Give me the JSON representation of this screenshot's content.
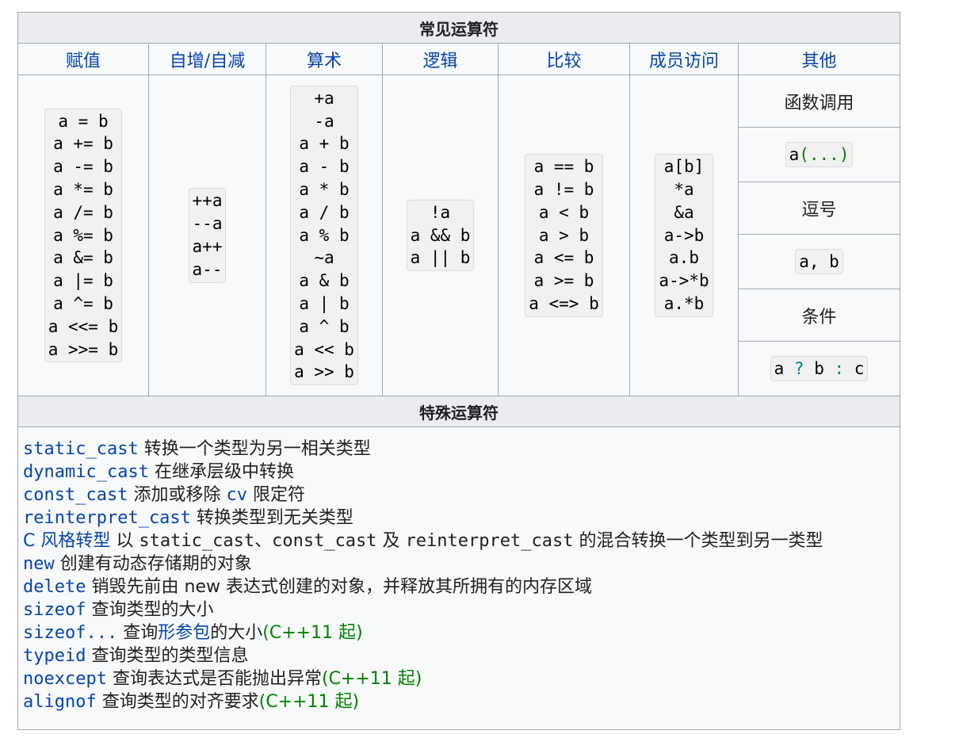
{
  "common": {
    "title": "常见运算符",
    "headers": [
      "赋值",
      "自增/自减",
      "算术",
      "逻辑",
      "比较",
      "成员访问",
      "其他"
    ],
    "assign": [
      "a = b",
      "a += b",
      "a -= b",
      "a *= b",
      "a /= b",
      "a %= b",
      "a &= b",
      "a |= b",
      "a ^= b",
      "a <<= b",
      "a >>= b"
    ],
    "incdec": [
      "++a",
      "--a",
      "a++",
      "a--"
    ],
    "arith": [
      "+a",
      "-a",
      "a + b",
      "a - b",
      "a * b",
      "a / b",
      "a % b",
      "~a",
      "a & b",
      "a | b",
      "a ^ b",
      "a << b",
      "a >> b"
    ],
    "logic": [
      "!a",
      "a && b",
      "a || b"
    ],
    "compare": [
      "a == b",
      "a != b",
      "a < b",
      "a > b",
      "a <= b",
      "a >= b",
      "a <=> b"
    ],
    "member": [
      "a[b]",
      "*a",
      "&a",
      "a->b",
      "a.b",
      "a->*b",
      "a.*b"
    ],
    "other": {
      "call_label": "函数调用",
      "call_code": "a(...)",
      "comma_label": "逗号",
      "comma_code": "a, b",
      "cond_label": "条件",
      "cond_code": "a ? b : c"
    }
  },
  "special": {
    "title": "特殊运算符",
    "lines": [
      {
        "name": "static_cast",
        "desc": "转换一个类型为另一相关类型"
      },
      {
        "name": "dynamic_cast",
        "desc": "在继承层级中转换"
      },
      {
        "name": "const_cast",
        "desc_pre": "添加或移除",
        "desc_code": "cv",
        "desc_post": "限定符"
      },
      {
        "name": "reinterpret_cast",
        "desc": "转换类型到无关类型"
      },
      {
        "name": "C 风格转型",
        "desc_1": "以",
        "code_1": "static_cast",
        "sep": "、",
        "code_2": "const_cast",
        "desc_2": "及",
        "code_3": "reinterpret_cast",
        "desc_3": "的混合转换一个类型到另一类型"
      },
      {
        "name": "new",
        "desc": "创建有动态存储期的对象"
      },
      {
        "name": "delete",
        "desc_pre": "销毁先前由",
        "desc_link": "new",
        "desc_post": "表达式创建的对象，并释放其所拥有的内存区域"
      },
      {
        "name": "sizeof",
        "desc": "查询类型的大小"
      },
      {
        "name": "sizeof...",
        "desc_pre": "查询",
        "desc_link": "形参包",
        "desc_post": "的大小",
        "since": "(C++11 起)"
      },
      {
        "name": "typeid",
        "desc": "查询类型的类型信息"
      },
      {
        "name": "noexcept",
        "desc": "查询表达式是否能抛出异常",
        "since": "(C++11 起)"
      },
      {
        "name": "alignof",
        "desc": "查询类型的对齐要求",
        "since": "(C++11 起)"
      }
    ]
  },
  "colors": {
    "link": "#0645ad",
    "header_bg": "#eaecf0",
    "table_bg": "#f8f9fa",
    "border": "#a2a9b1",
    "since_green": "#008000"
  }
}
